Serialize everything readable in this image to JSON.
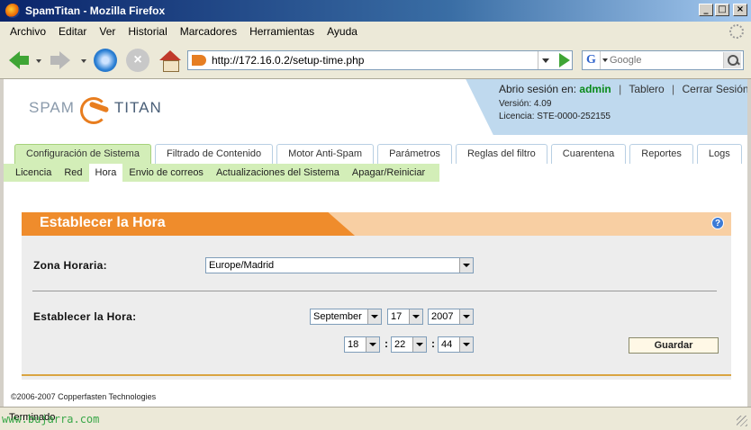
{
  "window": {
    "title": "SpamTitan - Mozilla Firefox",
    "buttons": {
      "minimize": "_",
      "maximize": "□",
      "close": "×"
    }
  },
  "menubar": [
    "Archivo",
    "Editar",
    "Ver",
    "Historial",
    "Marcadores",
    "Herramientas",
    "Ayuda"
  ],
  "toolbar": {
    "url": "http://172.16.0.2/setup-time.php",
    "search_placeholder": "Google",
    "search_engine_glyph": "G",
    "stop_glyph": "×"
  },
  "page": {
    "logo": {
      "left": "SPAM",
      "right": "TITAN"
    },
    "session": {
      "prefix": "Abrio sesión en:",
      "user": "admin",
      "dashboard": "Tablero",
      "logout": "Cerrar Sesión",
      "sep": "|"
    },
    "version": "Versión: 4.09",
    "license": "Licencia: STE-0000-252155",
    "tabs": [
      "Configuración de Sistema",
      "Filtrado de Contenido",
      "Motor Anti-Spam",
      "Parámetros",
      "Reglas del filtro",
      "Cuarentena",
      "Reportes",
      "Logs"
    ],
    "active_tab": 0,
    "subnav": [
      "Licencia",
      "Red",
      "Hora",
      "Envio de correos",
      "Actualizaciones del Sistema",
      "Apagar/Reiniciar"
    ],
    "active_subnav": 2,
    "panel": {
      "title": "Establecer la Hora",
      "help_glyph": "?",
      "timezone_label": "Zona Horaria:",
      "timezone_value": "Europe/Madrid",
      "settime_label": "Establecer la Hora:",
      "month": "September",
      "day": "17",
      "year": "2007",
      "hour": "18",
      "minute": "22",
      "second": "44",
      "colon": ":",
      "save_label": "Guardar"
    },
    "copyright": "©2006-2007 Copperfasten Technologies"
  },
  "status": {
    "text": "Terminado",
    "watermark": "www.bujarra.com"
  },
  "colors": {
    "accent_orange": "#ef8c2c",
    "header_blue": "#bfd9ee",
    "tab_active_green": "#d3eeb8",
    "user_green": "#0a8a1a"
  }
}
